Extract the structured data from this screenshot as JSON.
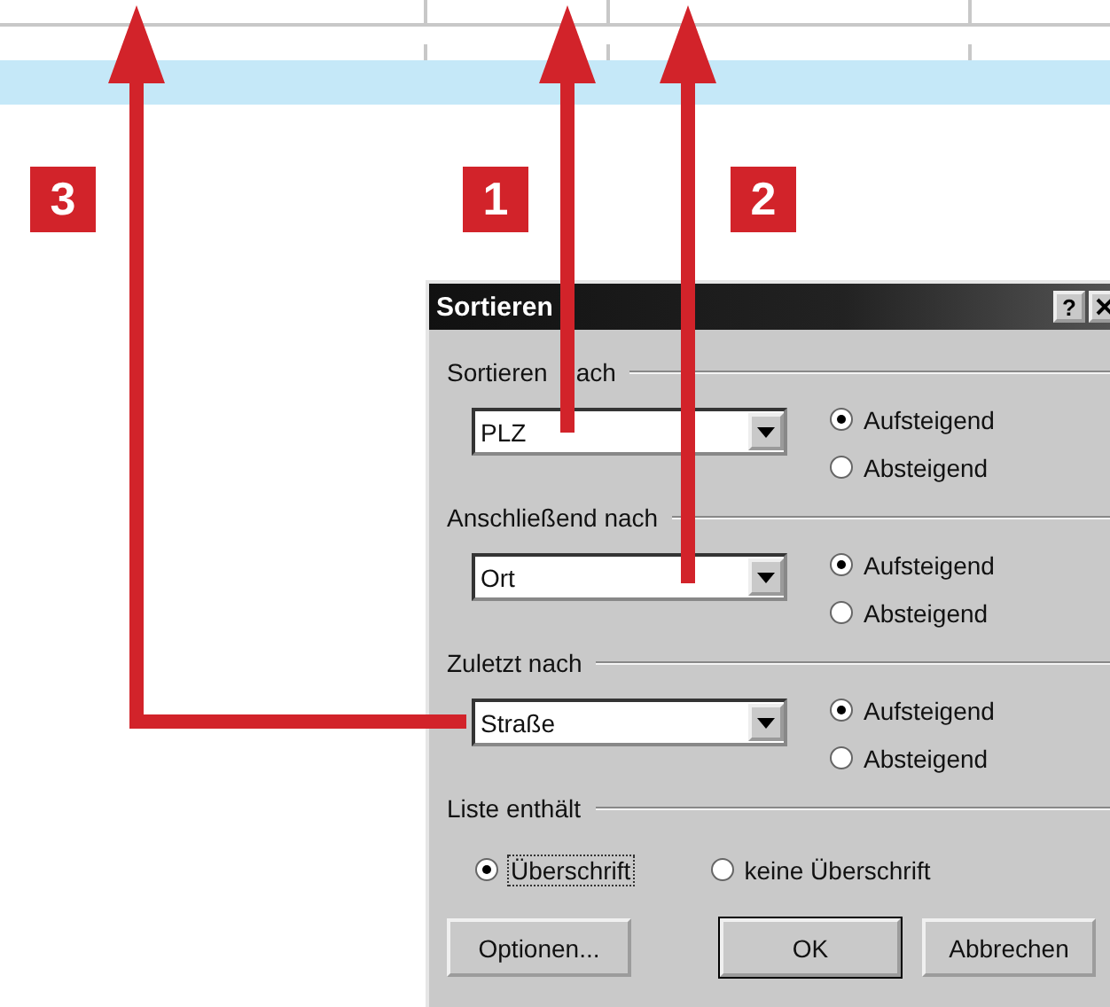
{
  "annotations": [
    {
      "label": "3"
    },
    {
      "label": "1"
    },
    {
      "label": "2"
    }
  ],
  "dialog": {
    "title": "Sortieren",
    "help_button": "?",
    "sort_keys": [
      {
        "label": [
          "Sortieren",
          "ach"
        ],
        "value": "PLZ",
        "options": [
          {
            "label": "Aufsteigend",
            "selected": true
          },
          {
            "label": "Absteigend",
            "selected": false
          }
        ]
      },
      {
        "label": [
          "Anschließend nach"
        ],
        "value": "Ort",
        "options": [
          {
            "label": "Aufsteigend",
            "selected": true
          },
          {
            "label": "Absteigend",
            "selected": false
          }
        ]
      },
      {
        "label": [
          "Zuletzt nach"
        ],
        "value": "Straße",
        "options": [
          {
            "label": "Aufsteigend",
            "selected": true
          },
          {
            "label": "Absteigend",
            "selected": false
          }
        ]
      }
    ],
    "list_header": {
      "label": "Liste enthält",
      "options": [
        {
          "label": "Überschrift",
          "selected": true,
          "focused": true
        },
        {
          "label": "keine Überschrift",
          "selected": false,
          "focused": false
        }
      ]
    },
    "buttons": [
      {
        "label": "Optionen...",
        "default": false
      },
      {
        "label": "OK",
        "default": true
      },
      {
        "label": "Abbrechen",
        "default": false
      }
    ]
  }
}
